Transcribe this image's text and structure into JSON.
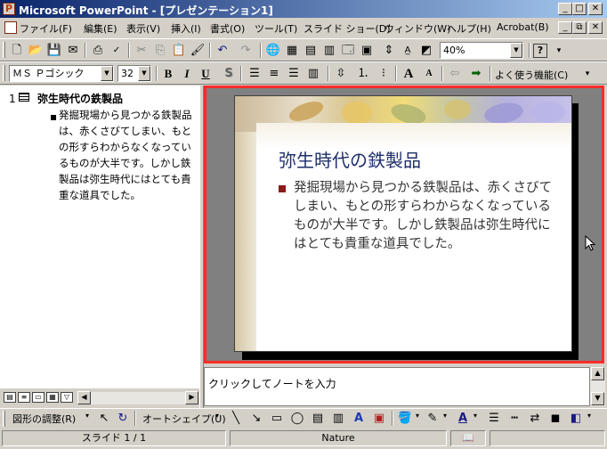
{
  "window": {
    "title": "Microsoft PowerPoint - [プレゼンテーション1]",
    "minimize_glyph": "_",
    "maximize_glyph": "□",
    "close_glyph": "✕"
  },
  "menubar": {
    "items": [
      "ファイル(F)",
      "編集(E)",
      "表示(V)",
      "挿入(I)",
      "書式(O)",
      "ツール(T)",
      "スライド ショー(D)",
      "ウィンドウ(W)",
      "ヘルプ(H)",
      "Acrobat(B)"
    ]
  },
  "standard_toolbar": {
    "zoom": "40%",
    "help_glyph": "?"
  },
  "format_toolbar": {
    "font": "ＭＳ Ｐゴシック",
    "size": "32",
    "bold": "B",
    "italic": "I",
    "underline": "U",
    "shadow": "S",
    "common_tasks": "よく使う機能(C)"
  },
  "outline": {
    "slide_number": "1",
    "title": "弥生時代の鉄製品",
    "bullet": "▪",
    "body": "発掘現場から見つかる鉄製品は、赤くさびてしまい、もとの形すらわからなくなっているものが大半です。しかし鉄製品は弥生時代にはとても貴重な道具でした。"
  },
  "slide": {
    "title": "弥生時代の鉄製品",
    "body": "発掘現場から見つかる鉄製品は、赤くさびてしまい、もとの形すらわからなくなっているものが大半です。しかし鉄製品は弥生時代にはとても貴重な道具でした。"
  },
  "notes": {
    "placeholder": "クリックしてノートを入力"
  },
  "drawing_toolbar": {
    "draw_menu": "図形の調整(R)",
    "autoshapes": "オートシェイプ(U)"
  },
  "status": {
    "slide_info": "スライド 1 / 1",
    "design": "Nature"
  },
  "colors": {
    "selection_border": "#ff2a2a",
    "slide_title": "#1f2e6a",
    "bullet": "#8b1a1a"
  }
}
